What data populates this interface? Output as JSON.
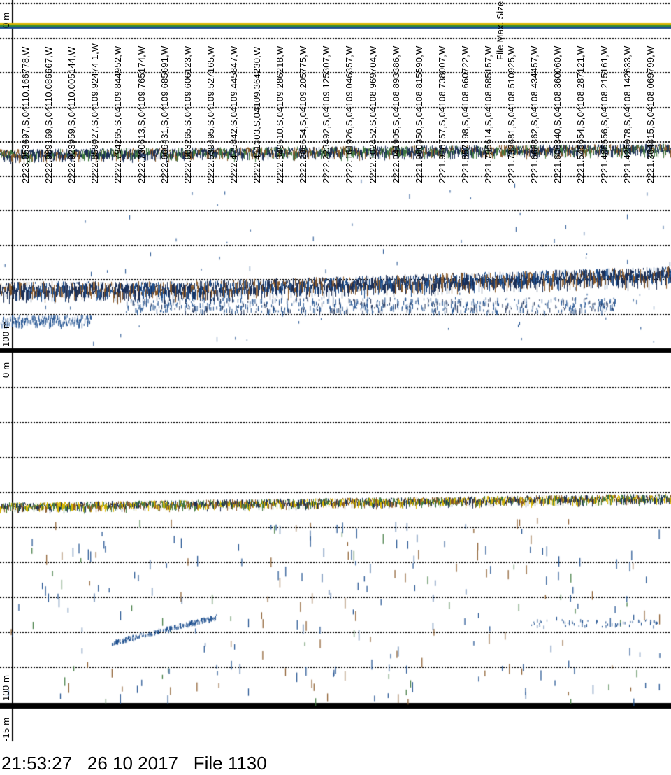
{
  "panels": {
    "top": {
      "depth_top_label": "0 m",
      "depth_bottom_label": "100 m"
    },
    "bottom": {
      "depth_top_label": "0 m",
      "depth_bottom_label": "100 m",
      "depth_offset_label": "-15 m"
    }
  },
  "annotations": [
    "2223.053697,S,04110.166778,W",
    "2222.989169,S,04110.086667,W",
    "2222.923959,S,04110.005144,W",
    "2222.859027,S,04109.92474 1,W",
    "2222.794265,S,04109.844952,W",
    "2222.730613,S,04109.765174,W",
    "2222.666431,S,04109.685691,W",
    "2222.603265,S,04109.606123,W",
    "2222.539495,S,04109.527165,W",
    "2222.475842,S,04109.445847,W",
    "2222.411303,S,04109.364230,W",
    "2222.349510,S,04109.286218,W",
    "2222.286654,S,04109.205775,W",
    "2222.223492,S,04109.125307,W",
    "2222.161926,S,04109.046357,W",
    "2222.102452,S,04108.969704,W",
    "2222.041905,S,04108.893386,W",
    "2221.980350,S,04108.815590,W",
    "2221.918757,S,04108.738007,W",
    "2221.857198,S,04108.660722,W",
    "2221.795614,S,04108.585157,W",
    "2221.732681,S,04108.510925,W",
    "2221.668862,S,04108.434457,W",
    "2221.606340,S,04108.360060,W",
    "2221.545654,S,04108.287121,W",
    "2221.485556,S,04108.215161,W",
    "2221.425078,S,04108.142633,W",
    "2221.364815,S,04108.069799,W"
  ],
  "file_max_label": "File Max. Size",
  "footer": {
    "time": "21:53:27",
    "date": "26 10 2017",
    "file": "File 1130"
  },
  "colors": {
    "background": "#ffffff",
    "grid": "#000000",
    "surface_yellow": "#d9b600",
    "surface_green": "#2f8a3a",
    "surface_blue": "#1d4f8f",
    "echo_dark": "#1b2f57",
    "echo_brown": "#8a5a2a",
    "echo_green": "#3f7a3f"
  }
}
